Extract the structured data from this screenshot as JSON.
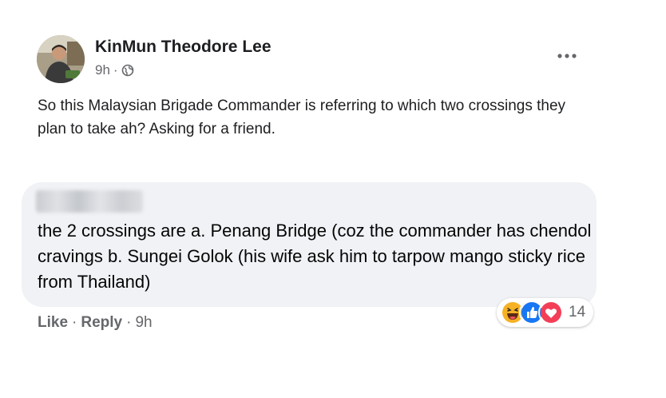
{
  "post": {
    "author": "KinMun Theodore Lee",
    "time": "9h",
    "separator": "·",
    "privacy_icon": "globe-icon",
    "more_icon": "more-options-icon",
    "text": "So this Malaysian Brigade Commander is referring to which two crossings they plan to take ah? Asking for a friend."
  },
  "comment": {
    "author_blurred": true,
    "text": "the 2 crossings are a. Penang Bridge (coz the commander has chendol cravings b. Sungei Golok (his wife ask him to tarpow mango sticky rice from Thailand)",
    "reactions": {
      "icons": [
        "haha-icon",
        "like-icon",
        "love-icon"
      ],
      "count": "14"
    },
    "actions": {
      "like": "Like",
      "sep1": "·",
      "reply": "Reply",
      "sep2": "·",
      "time": "9h"
    }
  },
  "colors": {
    "bubble": "#f0f2f5",
    "meta_text": "#65676b",
    "like_blue": "#1877f2",
    "love_red": "#f33e58",
    "haha_yellow": "#f7b125"
  }
}
